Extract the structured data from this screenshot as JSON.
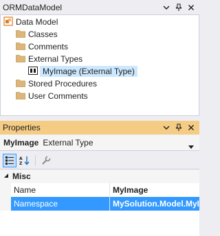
{
  "solution_panel": {
    "title": "ORMDataModel",
    "tree": {
      "root": "Data Model",
      "items": [
        {
          "label": "Classes"
        },
        {
          "label": "Comments"
        },
        {
          "label": "External Types"
        },
        {
          "label": "MyImage (External Type)"
        },
        {
          "label": "Stored Procedures"
        },
        {
          "label": "User Comments"
        }
      ]
    }
  },
  "properties_panel": {
    "title": "Properties",
    "object_name": "MyImage",
    "object_type": "External Type",
    "category": "Misc",
    "rows": [
      {
        "key": "Name",
        "value": "MyImage"
      },
      {
        "key": "Namespace",
        "value": "MySolution.Model.MyIm"
      }
    ]
  },
  "colors": {
    "active_title": "#f5cc84",
    "tree_selection": "#cce8ff",
    "grid_selection": "#3399ff",
    "folder": "#dcb67a"
  },
  "icons": [
    "window-position-icon",
    "pin-icon",
    "close-icon",
    "model-icon",
    "folder-icon",
    "external-type-icon",
    "categorized-icon",
    "alphabetical-icon",
    "property-pages-icon",
    "dropdown-icon"
  ]
}
